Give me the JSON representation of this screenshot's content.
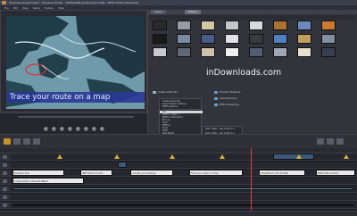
{
  "window": {
    "title": "Unknown Project.mpy* - Pinnacle Studio - 1920x1080 [Anamorphic] PAL / NTSC 29.97 [Standard]",
    "menus": [
      "File",
      "Edit",
      "View",
      "Setup",
      "Toolbox",
      "Help"
    ]
  },
  "preview": {
    "caption": "Trace your route on a map"
  },
  "library": {
    "tabs": [
      "Album",
      "Effects"
    ],
    "watermark": "inDownloads.com",
    "thumb_colors": [
      "#2a2a2a",
      "#9a9aa6",
      "#d3c6a4",
      "#c4c6cc",
      "#d9d9de",
      "#a87234",
      "#6a8abd",
      "#cc7a30",
      "#1a1a1a",
      "#7a8aa0",
      "#4a5a8a",
      "#e0e0e6",
      "#3a3a40",
      "#5080c0",
      "#c0a060",
      "#8090a0",
      "#c8c8d0",
      "#606878",
      "#d0c0b0",
      "#f0f0f0",
      "#506070",
      "#a0a8b8",
      "#e6e0d0",
      "#384050"
    ]
  },
  "context_menu": {
    "items": [
      "Create Video File",
      "Select Project Settings",
      "MPEG Options",
      "",
      "AVI",
      "MPEG-1 (DVD...)",
      "MPEG-2 (Standard)",
      "Blu-ray",
      "DivX",
      "MPEG-4",
      "Flash",
      "WMV",
      "Real Media",
      "",
      "3GP",
      "MP4, HDMI 1080p/Digital 5.1",
      "MP4, 1080i60Hz Digital 5.1"
    ],
    "selected_index": 4,
    "submenu": [
      "DVD, 30fps - Dig. Dolby 5.1",
      "DVD, 25fps - Dig. Dolby 5.1",
      "HDV 1080i - Dig. Dolby 5.1",
      "HDV 720p - Dig. Dolby 5.1",
      "Custom"
    ]
  },
  "options": {
    "items": [
      "Create Video File",
      "Program Playback",
      "Use Rendering",
      "MPEG Streaming"
    ]
  },
  "timeline": {
    "titles": [
      "Polished / Sect",
      "NEW Show 2 Coordi...",
      "animate your drawings",
      "Trace your route on a map",
      "Integrations in the art after",
      "Before Plan & Zoom"
    ],
    "track_label": "independently of the text effects"
  }
}
